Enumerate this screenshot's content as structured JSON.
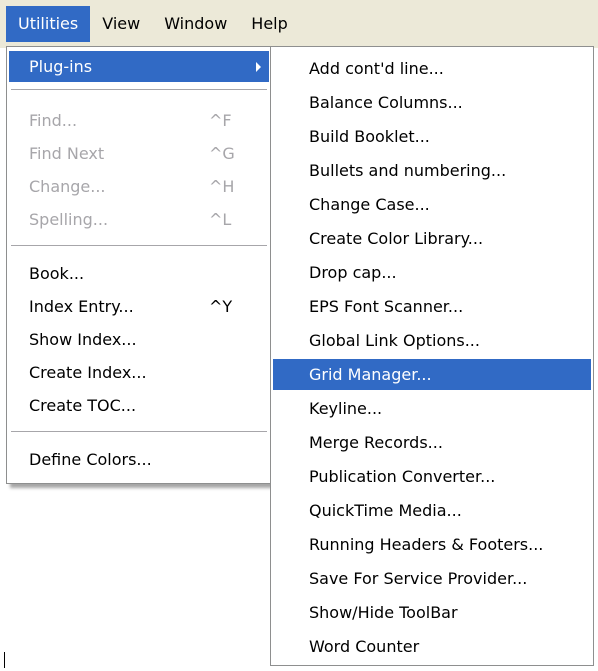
{
  "menubar": {
    "items": [
      "Utilities",
      "View",
      "Window",
      "Help"
    ],
    "active_index": 0
  },
  "utilities_menu": {
    "plugins_label": "Plug-ins",
    "find": {
      "label": "Find...",
      "shortcut": "^F"
    },
    "find_next": {
      "label": "Find Next",
      "shortcut": "^G"
    },
    "change": {
      "label": "Change...",
      "shortcut": "^H"
    },
    "spelling": {
      "label": "Spelling...",
      "shortcut": "^L"
    },
    "book": {
      "label": "Book..."
    },
    "index_entry": {
      "label": "Index Entry...",
      "shortcut": "^Y"
    },
    "show_index": {
      "label": "Show Index..."
    },
    "create_index": {
      "label": "Create Index..."
    },
    "create_toc": {
      "label": "Create TOC..."
    },
    "define_colors": {
      "label": "Define Colors..."
    }
  },
  "plugins_submenu": {
    "items": [
      "Add cont'd line...",
      "Balance Columns...",
      "Build Booklet...",
      "Bullets and numbering...",
      "Change Case...",
      "Create Color Library...",
      "Drop cap...",
      "EPS Font Scanner...",
      "Global Link Options...",
      "Grid Manager...",
      "Keyline...",
      "Merge Records...",
      "Publication Converter...",
      "QuickTime Media...",
      "Running Headers & Footers...",
      "Save For Service Provider...",
      "Show/Hide ToolBar",
      "Word Counter"
    ],
    "highlighted_index": 9
  },
  "colors": {
    "highlight": "#316ac5",
    "menubar_bg": "#ece9d8",
    "disabled_text": "#a7a6aa"
  }
}
